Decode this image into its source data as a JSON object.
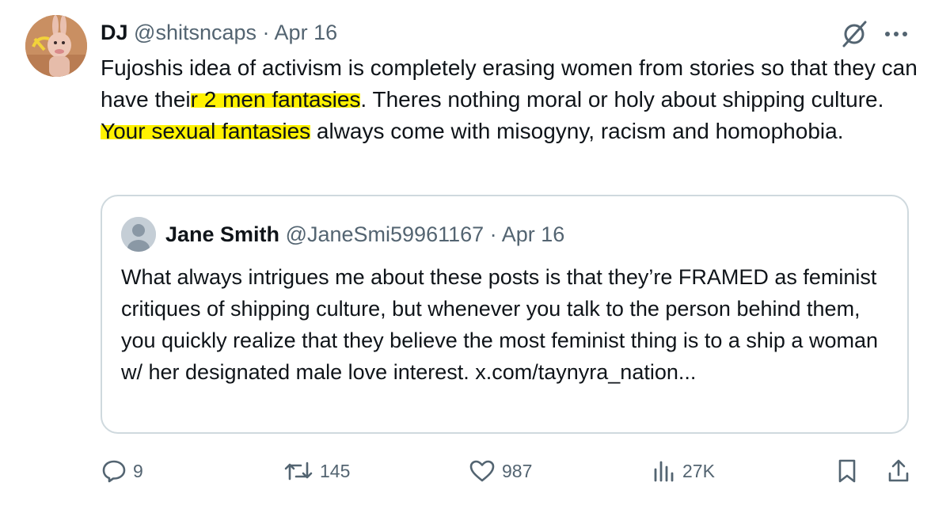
{
  "tweet": {
    "author_name": "DJ",
    "handle": "@shitsncaps",
    "separator": "·",
    "date": "Apr 16",
    "text_parts": [
      {
        "text": "Fujoshis idea of activism is completely erasing women from stories so that they can have thei",
        "highlight": false
      },
      {
        "text": "r 2 men fantasies",
        "highlight": true
      },
      {
        "text": ". Theres nothing moral or holy about shipping culture. ",
        "highlight": false
      },
      {
        "text": "Your sexual fantasies",
        "highlight": true
      },
      {
        "text": " always come with misogyny, racism and homophobia.",
        "highlight": false
      }
    ]
  },
  "quote": {
    "author_name": "Jane Smith",
    "handle": "@JaneSmi59961167",
    "separator": "·",
    "date": "Apr 16",
    "text": "What always intrigues me about these posts is that they’re FRAMED as feminist critiques of shipping culture, but whenever you talk to the person behind them, you quickly realize that they believe the most feminist thing is to a ship a woman w/ her designated male love interest. x.com/taynyra_nation..."
  },
  "actions": {
    "replies": "9",
    "reposts": "145",
    "likes": "987",
    "views": "27K"
  },
  "colors": {
    "highlight": "#fff200",
    "muted": "#536471",
    "border": "#cfd9de"
  }
}
